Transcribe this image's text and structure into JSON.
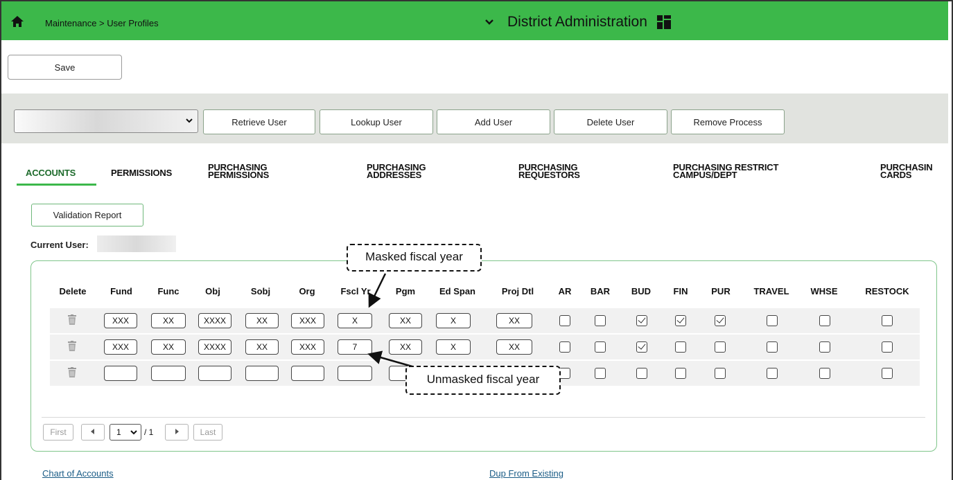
{
  "header": {
    "breadcrumb": "Maintenance > User Profiles",
    "title": "District Administration",
    "icons": [
      "home-icon",
      "chevron-down-icon",
      "grid-icon"
    ],
    "bar_color": "#3cb84a"
  },
  "actions": {
    "save_label": "Save"
  },
  "toolbar": {
    "user_select_value": "",
    "buttons": [
      "Retrieve User",
      "Lookup User",
      "Add User",
      "Delete User",
      "Remove Process"
    ]
  },
  "tabs": [
    {
      "line1": "ACCOUNTS",
      "line2": "",
      "active": true
    },
    {
      "line1": "PERMISSIONS",
      "line2": ""
    },
    {
      "line1": "PURCHASING",
      "line2": "PERMISSIONS"
    },
    {
      "line1": "PURCHASING",
      "line2": "ADDRESSES"
    },
    {
      "line1": "PURCHASING",
      "line2": "REQUESTORS"
    },
    {
      "line1": "PURCHASING RESTRICT",
      "line2": "CAMPUS/DEPT"
    },
    {
      "line1": "PURCHASIN",
      "line2": "CARDS"
    }
  ],
  "validation_report_label": "Validation Report",
  "current_user_label": "Current User:",
  "grid": {
    "headers": [
      "Delete",
      "Fund",
      "Func",
      "Obj",
      "Sobj",
      "Org",
      "Fscl Yr",
      "Pgm",
      "Ed Span",
      "Proj Dtl",
      "AR",
      "BAR",
      "BUD",
      "FIN",
      "PUR",
      "TRAVEL",
      "WHSE",
      "RESTOCK"
    ],
    "rows": [
      {
        "values": [
          "XXX",
          "XX",
          "XXXX",
          "XX",
          "XXX",
          "X",
          "XX",
          "X",
          "XX"
        ],
        "checks": [
          false,
          false,
          true,
          true,
          true,
          false,
          false,
          false
        ]
      },
      {
        "values": [
          "XXX",
          "XX",
          "XXXX",
          "XX",
          "XXX",
          "7",
          "XX",
          "X",
          "XX"
        ],
        "checks": [
          false,
          false,
          true,
          false,
          false,
          false,
          false,
          false
        ]
      },
      {
        "values": [
          "",
          "",
          "",
          "",
          "",
          "",
          "",
          "",
          ""
        ],
        "checks": [
          false,
          false,
          false,
          false,
          false,
          false,
          false,
          false
        ]
      }
    ]
  },
  "pager": {
    "first": "First",
    "last": "Last",
    "page": "1",
    "of": "/ 1"
  },
  "callouts": {
    "masked": "Masked fiscal year",
    "unmasked": "Unmasked fiscal year"
  },
  "links": {
    "chart_of_accounts": "Chart of Accounts",
    "dup_from_existing": "Dup From Existing"
  }
}
